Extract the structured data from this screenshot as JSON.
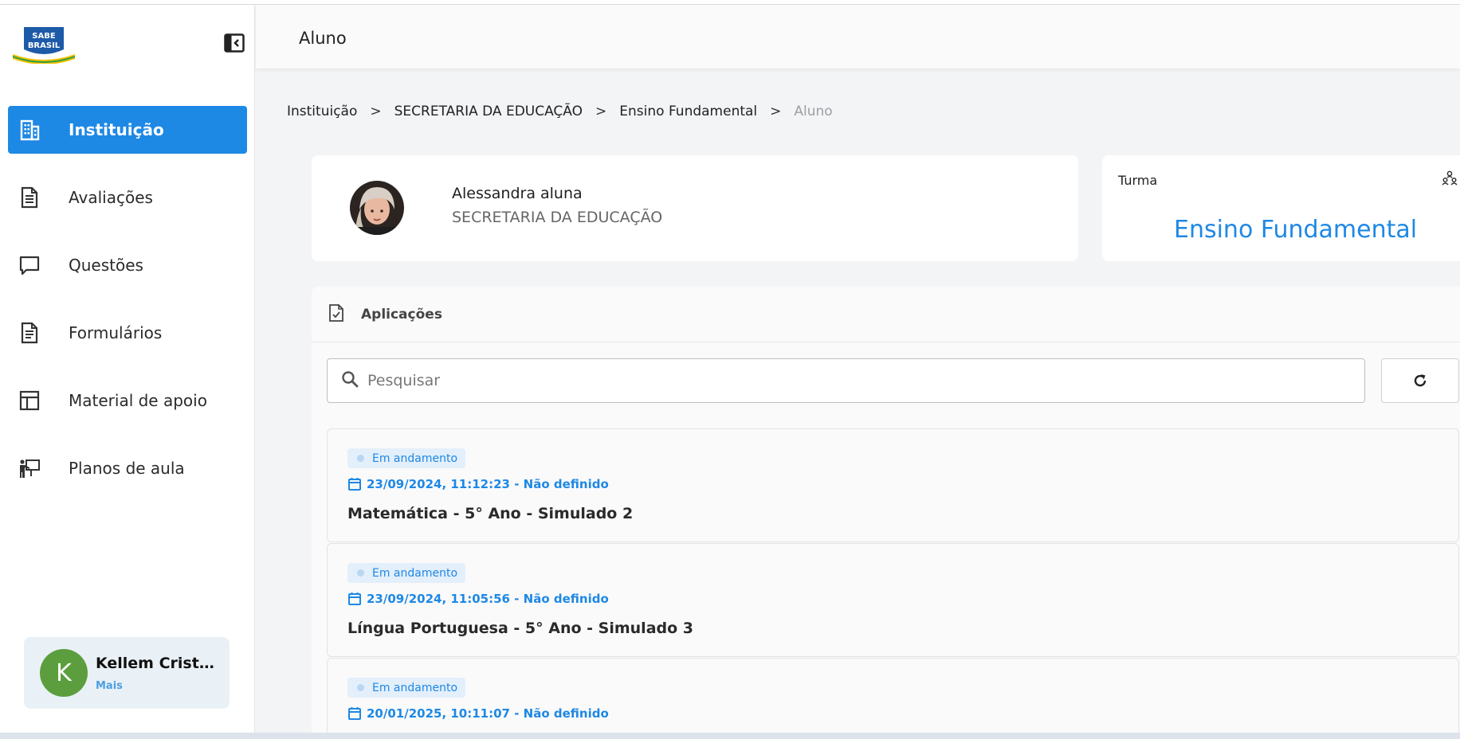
{
  "logo": {
    "line1": "SABE",
    "line2": "BRASIL"
  },
  "sidebar": {
    "items": [
      {
        "label": "Instituição",
        "icon": "building-icon",
        "active": true
      },
      {
        "label": "Avaliações",
        "icon": "document-icon",
        "active": false
      },
      {
        "label": "Questões",
        "icon": "chat-bubble-icon",
        "active": false
      },
      {
        "label": "Formulários",
        "icon": "form-icon",
        "active": false
      },
      {
        "label": "Material de apoio",
        "icon": "layout-icon",
        "active": false
      },
      {
        "label": "Planos de aula",
        "icon": "teacher-board-icon",
        "active": false
      }
    ],
    "user": {
      "initial": "K",
      "name": "Kellem Cristi...",
      "more": "Mais"
    }
  },
  "header": {
    "title": "Aluno"
  },
  "breadcrumb": {
    "items": [
      "Instituição",
      "SECRETARIA DA EDUCAÇÃO",
      "Ensino Fundamental",
      "Aluno"
    ],
    "separator": ">"
  },
  "profile": {
    "name": "Alessandra aluna",
    "institution": "SECRETARIA DA EDUCAÇÃO"
  },
  "turma": {
    "label": "Turma",
    "value": "Ensino Fundamental"
  },
  "applications": {
    "title": "Aplicações",
    "search_placeholder": "Pesquisar",
    "items": [
      {
        "status": "Em andamento",
        "date": "23/09/2024, 11:12:23 - Não definido",
        "title": "Matemática - 5° Ano - Simulado 2"
      },
      {
        "status": "Em andamento",
        "date": "23/09/2024, 11:05:56 - Não definido",
        "title": "Língua Portuguesa - 5° Ano - Simulado 3"
      },
      {
        "status": "Em andamento",
        "date": "20/01/2025, 10:11:07 - Não definido",
        "title": ""
      }
    ]
  },
  "colors": {
    "accent": "#1e88e5",
    "avatar": "#5c9e3e",
    "badge_bg": "#e3effb"
  }
}
